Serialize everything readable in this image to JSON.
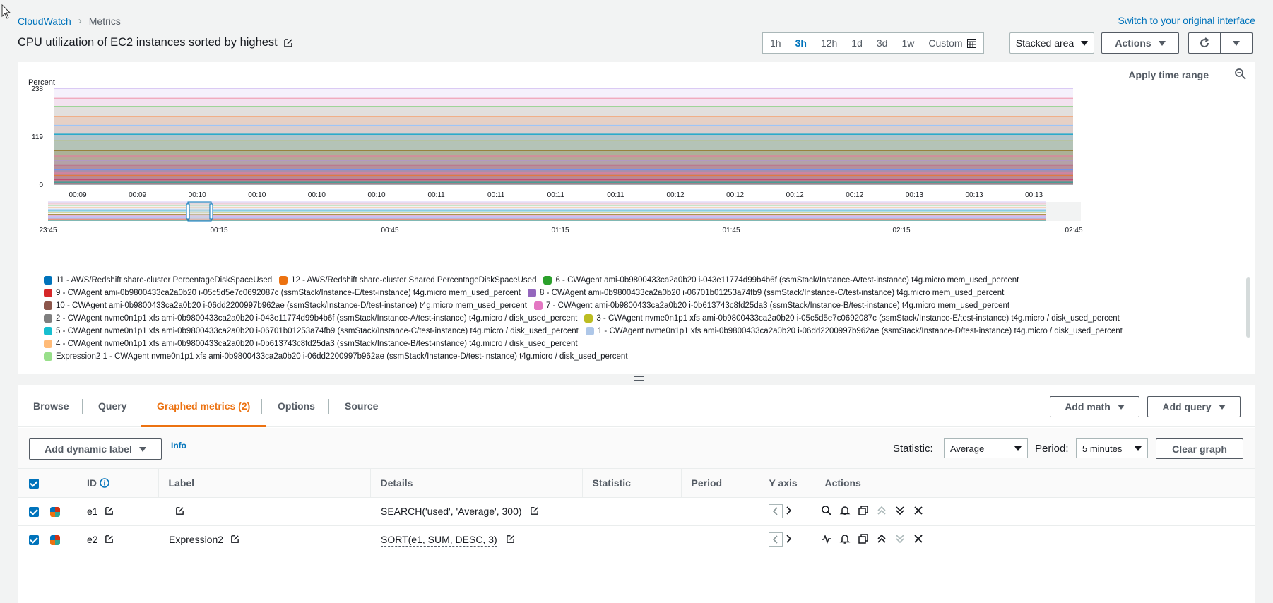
{
  "breadcrumb": {
    "root": "CloudWatch",
    "current": "Metrics"
  },
  "switch_link": "Switch to your original interface",
  "page_title": "CPU utilization of EC2 instances sorted by highest",
  "time_range": {
    "options": [
      "1h",
      "3h",
      "12h",
      "1d",
      "3d",
      "1w",
      "Custom"
    ],
    "active": "3h"
  },
  "view_select": "Stacked area",
  "actions_label": "Actions",
  "graph": {
    "y_unit": "Percent",
    "apply_time_range": "Apply time range",
    "y_ticks": [
      "238",
      "119",
      "0"
    ],
    "x_ticks": [
      "00:09",
      "00:09",
      "00:10",
      "00:10",
      "00:10",
      "00:10",
      "00:11",
      "00:11",
      "00:11",
      "00:11",
      "00:12",
      "00:12",
      "00:12",
      "00:12",
      "00:13",
      "00:13",
      "00:13"
    ],
    "overview_ticks": [
      "23:45",
      "00:15",
      "00:45",
      "01:15",
      "01:45",
      "02:15",
      "02:45"
    ]
  },
  "chart_data": {
    "type": "area",
    "ylabel": "Percent",
    "ylim": [
      0,
      238
    ],
    "x": [
      "00:09",
      "00:09",
      "00:10",
      "00:10",
      "00:10",
      "00:10",
      "00:11",
      "00:11",
      "00:11",
      "00:11",
      "00:12",
      "00:12",
      "00:12",
      "00:12",
      "00:13",
      "00:13",
      "00:13"
    ],
    "stacked_layers": [
      {
        "color": "#2ea597",
        "top": 5
      },
      {
        "color": "#c33d69",
        "top": 12
      },
      {
        "color": "#e07941",
        "top": 22
      },
      {
        "color": "#e07f9d",
        "top": 28
      },
      {
        "color": "#7492e7",
        "top": 36
      },
      {
        "color": "#c33d69",
        "top": 48
      },
      {
        "color": "#b088f5",
        "top": 60
      },
      {
        "color": "#e07f9d",
        "top": 70
      },
      {
        "color": "#8d6605",
        "top": 84
      },
      {
        "color": "#bfbf5a",
        "top": 108
      },
      {
        "color": "#00a1c9",
        "top": 124
      },
      {
        "color": "#9ec5f7",
        "top": 146
      },
      {
        "color": "#f89256",
        "top": 168
      },
      {
        "color": "#93d28c",
        "top": 193
      },
      {
        "color": "#f0a3b8",
        "top": 213
      },
      {
        "color": "#c9b3f0",
        "top": 238
      }
    ]
  },
  "legend": [
    [
      {
        "label": "11 - AWS/Redshift share-cluster PercentageDiskSpaceUsed",
        "color": "#0073bb"
      },
      {
        "label": "12 - AWS/Redshift share-cluster Shared PercentageDiskSpaceUsed",
        "color": "#ec7211"
      },
      {
        "label": "6 - CWAgent ami-0b9800433ca2a0b20 i-043e11774d99b4b6f (ssmStack/Instance-A/test-instance) t4g.micro mem_used_percent",
        "color": "#2ca02c"
      }
    ],
    [
      {
        "label": "9 - CWAgent ami-0b9800433ca2a0b20 i-05c5d5e7c0692087c (ssmStack/Instance-E/test-instance) t4g.micro mem_used_percent",
        "color": "#d62728"
      },
      {
        "label": "8 - CWAgent ami-0b9800433ca2a0b20 i-06701b01253a74fb9 (ssmStack/Instance-C/test-instance) t4g.micro mem_used_percent",
        "color": "#9467bd"
      }
    ],
    [
      {
        "label": "10 - CWAgent ami-0b9800433ca2a0b20 i-06dd2200997b962ae (ssmStack/Instance-D/test-instance) t4g.micro mem_used_percent",
        "color": "#8c564b"
      },
      {
        "label": "7 - CWAgent ami-0b9800433ca2a0b20 i-0b613743c8fd25da3 (ssmStack/Instance-B/test-instance) t4g.micro mem_used_percent",
        "color": "#e377c2"
      }
    ],
    [
      {
        "label": "2 - CWAgent nvme0n1p1 xfs ami-0b9800433ca2a0b20 i-043e11774d99b4b6f (ssmStack/Instance-A/test-instance) t4g.micro / disk_used_percent",
        "color": "#7f7f7f"
      },
      {
        "label": "3 - CWAgent nvme0n1p1 xfs ami-0b9800433ca2a0b20 i-05c5d5e7c0692087c (ssmStack/Instance-E/test-instance) t4g.micro / disk_used_percent",
        "color": "#bcbd22"
      }
    ],
    [
      {
        "label": "5 - CWAgent nvme0n1p1 xfs ami-0b9800433ca2a0b20 i-06701b01253a74fb9 (ssmStack/Instance-C/test-instance) t4g.micro / disk_used_percent",
        "color": "#17becf"
      },
      {
        "label": "1 - CWAgent nvme0n1p1 xfs ami-0b9800433ca2a0b20 i-06dd2200997b962ae (ssmStack/Instance-D/test-instance) t4g.micro / disk_used_percent",
        "color": "#aec7e8"
      }
    ],
    [
      {
        "label": "4 - CWAgent nvme0n1p1 xfs ami-0b9800433ca2a0b20 i-0b613743c8fd25da3 (ssmStack/Instance-B/test-instance) t4g.micro / disk_used_percent",
        "color": "#ffbb78"
      }
    ],
    [
      {
        "label": "Expression2 1 - CWAgent nvme0n1p1 xfs ami-0b9800433ca2a0b20 i-06dd2200997b962ae (ssmStack/Instance-D/test-instance) t4g.micro / disk_used_percent",
        "color": "#98df8a"
      }
    ]
  ],
  "tabs": [
    "Browse",
    "Query",
    "Graphed metrics (2)",
    "Options",
    "Source"
  ],
  "active_tab": "Graphed metrics (2)",
  "add_math": "Add math",
  "add_query": "Add query",
  "add_dynamic_label": "Add dynamic label",
  "info": "Info",
  "statistic_label": "Statistic:",
  "statistic_value": "Average",
  "period_label": "Period:",
  "period_value": "5 minutes",
  "clear_graph": "Clear graph",
  "columns": [
    "ID",
    "Label",
    "Details",
    "Statistic",
    "Period",
    "Y axis",
    "Actions"
  ],
  "rows": [
    {
      "id": "e1",
      "label": "",
      "details": "SEARCH('used', 'Average', 300)"
    },
    {
      "id": "e2",
      "label": "Expression2",
      "details": "SORT(e1, SUM, DESC, 3)"
    }
  ]
}
